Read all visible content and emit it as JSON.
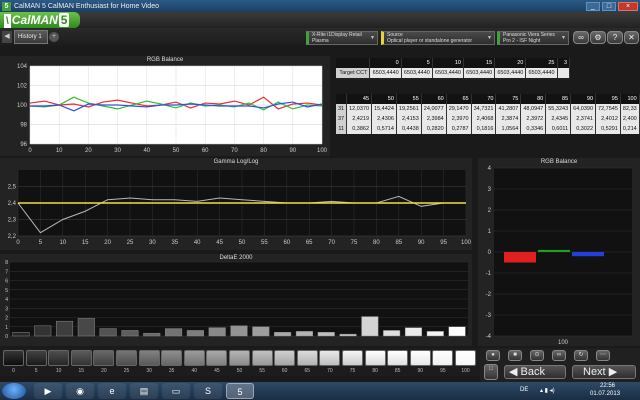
{
  "window": {
    "title": "CalMAN 5 CalMAN Enthusiast for Home Video"
  },
  "header": {
    "logo": "CalMAN",
    "logo_version": "5",
    "subtitle": "CalMAN Enthusiast for Home Video"
  },
  "tabs": {
    "history": "History 1",
    "add": "+"
  },
  "devices": [
    {
      "line1": "X-Rite i1Display Retail",
      "line2": "Plasma"
    },
    {
      "line1": "Source",
      "line2": "Optical player or standalone generator"
    },
    {
      "line1": "Panasonic Viera Series",
      "line2": "Pro 2 - ISF Night"
    }
  ],
  "toolbar_icons": [
    "link-icon",
    "settings-icon",
    "help-icon",
    "close-icon"
  ],
  "rgb_panel": {
    "title": "RGB Balance"
  },
  "gamma_panel": {
    "title": "Gamma Log/Log"
  },
  "deltae_panel": {
    "title": "DeltaE 2000"
  },
  "rgb_bar_panel": {
    "title": "RGB Balance",
    "x_label": "100"
  },
  "cct_table": {
    "headers": [
      "0",
      "5",
      "10",
      "15",
      "20",
      "25",
      "3"
    ],
    "row_label": "Target CCT",
    "values": [
      "6503,4440",
      "6503,4440",
      "6503,4440",
      "6503,4440",
      "6503,4440",
      "6503,4440"
    ]
  },
  "data_table": {
    "headers": [
      "45",
      "50",
      "55",
      "60",
      "65",
      "70",
      "75",
      "80",
      "85",
      "90",
      "95",
      "100"
    ],
    "rows": [
      {
        "label": "31",
        "values": [
          "12,0370",
          "15,4424",
          "19,2561",
          "24,0077",
          "29,1470",
          "34,7321",
          "41,2807",
          "48,0947",
          "55,3243",
          "64,0390",
          "72,7545",
          "82,33"
        ]
      },
      {
        "label": "37",
        "values": [
          "2,4219",
          "2,4306",
          "2,4153",
          "2,3984",
          "2,3970",
          "2,4068",
          "2,3874",
          "2,3972",
          "2,4345",
          "2,3741",
          "2,4012",
          "2,400"
        ]
      },
      {
        "label": "11",
        "values": [
          "0,3862",
          "0,5714",
          "0,4438",
          "0,2820",
          "0,2787",
          "0,1816",
          "1,0564",
          "0,3346",
          "0,6011",
          "0,3022",
          "0,5291",
          "0,214"
        ]
      }
    ]
  },
  "chart_data": [
    {
      "type": "line",
      "title": "RGB Balance",
      "x": [
        0,
        5,
        10,
        15,
        20,
        25,
        30,
        35,
        40,
        45,
        50,
        55,
        60,
        65,
        70,
        75,
        80,
        85,
        90,
        95,
        100
      ],
      "ylim": [
        96,
        104
      ],
      "xlim": [
        0,
        100
      ],
      "x_ticks": [
        0,
        10,
        20,
        30,
        40,
        50,
        60,
        70,
        80,
        90,
        100
      ],
      "y_ticks": [
        96,
        98,
        100,
        102,
        104
      ],
      "series": [
        {
          "color": "#e83030",
          "values": [
            100.2,
            100.4,
            100.0,
            100.1,
            99.8,
            100.3,
            100.5,
            100.2,
            99.9,
            100.0,
            100.3,
            99.7,
            100.2,
            100.1,
            100.4,
            100.0,
            100.8,
            99.6,
            100.1,
            100.2,
            100.0
          ]
        },
        {
          "color": "#30c030",
          "values": [
            99.9,
            99.8,
            100.0,
            100.8,
            100.2,
            99.9,
            99.6,
            100.0,
            100.4,
            100.1,
            99.7,
            100.2,
            99.9,
            100.0,
            99.8,
            100.2,
            99.5,
            100.3,
            99.6,
            100.0,
            99.9
          ]
        },
        {
          "color": "#3050e8",
          "values": [
            99.9,
            99.9,
            100.0,
            99.4,
            100.1,
            100.0,
            100.0,
            99.9,
            99.8,
            100.0,
            100.0,
            100.1,
            100.0,
            99.9,
            99.9,
            99.9,
            99.7,
            100.1,
            100.3,
            99.8,
            100.1
          ]
        }
      ]
    },
    {
      "type": "line",
      "title": "Gamma Log/Log",
      "x": [
        0,
        5,
        10,
        15,
        20,
        25,
        30,
        35,
        40,
        45,
        50,
        55,
        60,
        65,
        70,
        75,
        80,
        85,
        90,
        95,
        100
      ],
      "ylim": [
        2.2,
        2.6
      ],
      "xlim": [
        0,
        100
      ],
      "x_ticks": [
        0,
        5,
        10,
        15,
        20,
        25,
        30,
        35,
        40,
        45,
        50,
        55,
        60,
        65,
        70,
        75,
        80,
        85,
        90,
        95,
        100
      ],
      "y_ticks": [
        2.2,
        2.3,
        2.4,
        2.5
      ],
      "series": [
        {
          "color": "#b8b8b8",
          "values": [
            2.4,
            2.22,
            2.3,
            2.35,
            2.42,
            2.43,
            2.42,
            2.42,
            2.41,
            2.43,
            2.42,
            2.41,
            2.4,
            2.4,
            2.41,
            2.4,
            2.4,
            2.44,
            2.38,
            2.4,
            2.4
          ]
        },
        {
          "color": "#f0e040",
          "values": [
            2.4,
            2.4,
            2.4,
            2.4,
            2.4,
            2.4,
            2.4,
            2.4,
            2.4,
            2.4,
            2.4,
            2.4,
            2.4,
            2.4,
            2.4,
            2.4,
            2.4,
            2.4,
            2.4,
            2.4,
            2.4
          ]
        }
      ]
    },
    {
      "type": "bar",
      "title": "DeltaE 2000",
      "categories": [
        "0",
        "5",
        "10",
        "15",
        "20",
        "25",
        "30",
        "35",
        "40",
        "45",
        "50",
        "55",
        "60",
        "65",
        "70",
        "75",
        "80",
        "85",
        "90",
        "95",
        "100"
      ],
      "values": [
        0.4,
        1.1,
        1.6,
        1.9,
        0.8,
        0.6,
        0.3,
        0.8,
        0.6,
        0.9,
        1.1,
        1.0,
        0.4,
        0.5,
        0.4,
        0.2,
        2.1,
        0.6,
        0.9,
        0.5,
        1.0
      ],
      "ylim": [
        0,
        8
      ],
      "y_ticks": [
        0,
        1,
        2,
        3,
        4,
        5,
        6,
        7,
        8
      ]
    },
    {
      "type": "bar",
      "title": "RGB Balance",
      "categories": [
        "R",
        "G",
        "B"
      ],
      "values": [
        -0.5,
        0.1,
        -0.2
      ],
      "colors": [
        "#e02020",
        "#20a020",
        "#2040e0"
      ],
      "ylim": [
        -4,
        4
      ],
      "y_ticks": [
        -4,
        -3,
        -2,
        -1,
        0,
        1,
        2,
        3,
        4
      ],
      "xlabel": "100"
    }
  ],
  "swatches": {
    "labels": [
      "0",
      "5",
      "10",
      "15",
      "20",
      "25",
      "30",
      "35",
      "40",
      "45",
      "50",
      "55",
      "60",
      "65",
      "70",
      "75",
      "80",
      "85",
      "90",
      "95",
      "100"
    ],
    "levels": [
      0.05,
      0.1,
      0.15,
      0.2,
      0.25,
      0.3,
      0.35,
      0.4,
      0.45,
      0.5,
      0.55,
      0.6,
      0.65,
      0.7,
      0.75,
      0.8,
      0.85,
      0.88,
      0.91,
      0.94,
      0.97
    ]
  },
  "nav": {
    "back": "Back",
    "next": "Next"
  },
  "taskbar": {
    "lang": "DE",
    "time": "22:56",
    "date": "01.07.2013"
  }
}
